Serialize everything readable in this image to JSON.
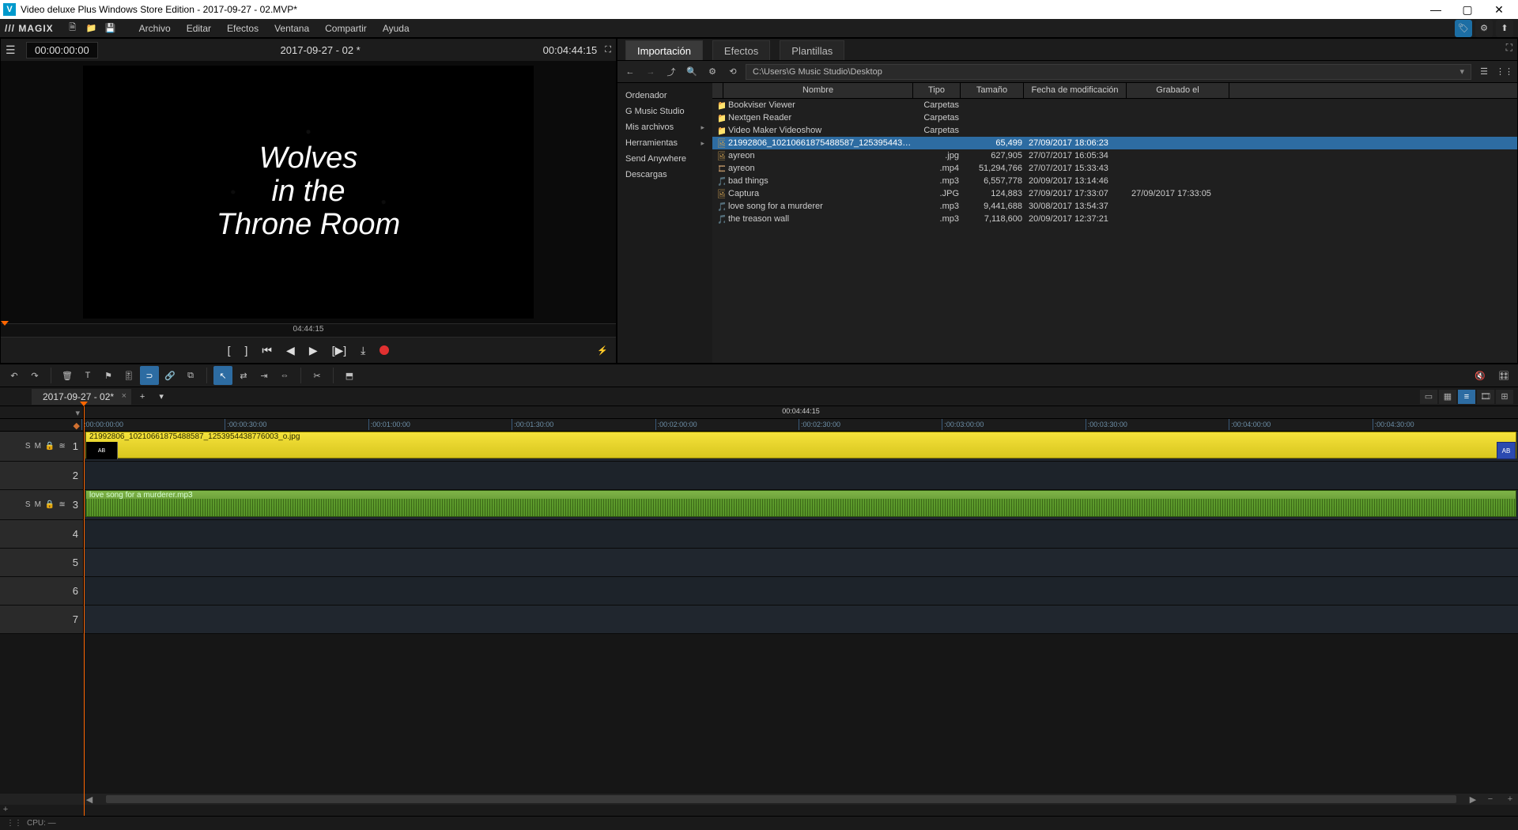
{
  "window": {
    "title": "Video deluxe Plus Windows Store Edition - 2017-09-27 - 02.MVP*"
  },
  "menu": {
    "brand": "/// MAGIX",
    "items": [
      "Archivo",
      "Editar",
      "Efectos",
      "Ventana",
      "Compartir",
      "Ayuda"
    ]
  },
  "preview": {
    "pos": "00:00:00:00",
    "title": "2017-09-27 - 02 *",
    "duration": "00:04:44:15",
    "scrub_time": "04:44:15",
    "image_text": "Wolves\nin the\nThrone Room"
  },
  "media": {
    "tabs": [
      "Importación",
      "Efectos",
      "Plantillas"
    ],
    "active_tab": 0,
    "path": "C:\\Users\\G Music Studio\\Desktop",
    "nav": [
      {
        "label": "Ordenador",
        "expandable": false
      },
      {
        "label": "G Music Studio",
        "expandable": false
      },
      {
        "label": "Mis archivos",
        "expandable": true
      },
      {
        "label": "Herramientas",
        "expandable": true
      },
      {
        "label": "Send Anywhere",
        "expandable": false
      },
      {
        "label": "Descargas",
        "expandable": false
      }
    ],
    "columns": [
      "Nombre",
      "Tipo",
      "Tamaño",
      "Fecha de modificación",
      "Grabado el"
    ],
    "files": [
      {
        "icon": "folder",
        "name": "Bookviser Viewer",
        "type": "Carpetas",
        "size": "",
        "mod": "",
        "rec": ""
      },
      {
        "icon": "folder",
        "name": "Nextgen Reader",
        "type": "Carpetas",
        "size": "",
        "mod": "",
        "rec": ""
      },
      {
        "icon": "folder",
        "name": "Video Maker Videoshow",
        "type": "Carpetas",
        "size": "",
        "mod": "",
        "rec": ""
      },
      {
        "icon": "img",
        "name": "21992806_10210661875488587_1253954438776003_o",
        "type": "",
        "size": "65,499",
        "mod": "27/09/2017 18:06:23",
        "rec": "",
        "selected": true
      },
      {
        "icon": "img",
        "name": "ayreon",
        "type": ".jpg",
        "size": "627,905",
        "mod": "27/07/2017 16:05:34",
        "rec": ""
      },
      {
        "icon": "vid",
        "name": "ayreon",
        "type": ".mp4",
        "size": "51,294,766",
        "mod": "27/07/2017 15:33:43",
        "rec": ""
      },
      {
        "icon": "aud",
        "name": "bad things",
        "type": ".mp3",
        "size": "6,557,778",
        "mod": "20/09/2017 13:14:46",
        "rec": ""
      },
      {
        "icon": "img",
        "name": "Captura",
        "type": ".JPG",
        "size": "124,883",
        "mod": "27/09/2017 17:33:07",
        "rec": "27/09/2017 17:33:05"
      },
      {
        "icon": "aud",
        "name": "love song for a murderer",
        "type": ".mp3",
        "size": "9,441,688",
        "mod": "30/08/2017 13:54:37",
        "rec": ""
      },
      {
        "icon": "aud",
        "name": "the treason wall",
        "type": ".mp3",
        "size": "7,118,600",
        "mod": "20/09/2017 12:37:21",
        "rec": ""
      }
    ]
  },
  "project_tab": "2017-09-27 - 02*",
  "timeline": {
    "duration": "00:04:44:15",
    "ticks": [
      ":00:00:00:00",
      ":00:00:30:00",
      ":00:01:00:00",
      ":00:01:30:00",
      ":00:02:00:00",
      ":00:02:30:00",
      ":00:03:00:00",
      ":00:03:30:00",
      ":00:04:00:00",
      ":00:04:30:00"
    ],
    "tracks": [
      {
        "num": "1",
        "controls": true
      },
      {
        "num": "2",
        "controls": false
      },
      {
        "num": "3",
        "controls": true
      },
      {
        "num": "4",
        "controls": false
      },
      {
        "num": "5",
        "controls": false
      },
      {
        "num": "6",
        "controls": false
      },
      {
        "num": "7",
        "controls": false
      }
    ],
    "clip_image": "21992806_10210661875488587_1253954438776003_o.jpg",
    "clip_audio": "love song for a murderer.mp3",
    "track_ctrl": [
      "S",
      "M"
    ]
  },
  "status": {
    "cpu": "CPU: —"
  }
}
